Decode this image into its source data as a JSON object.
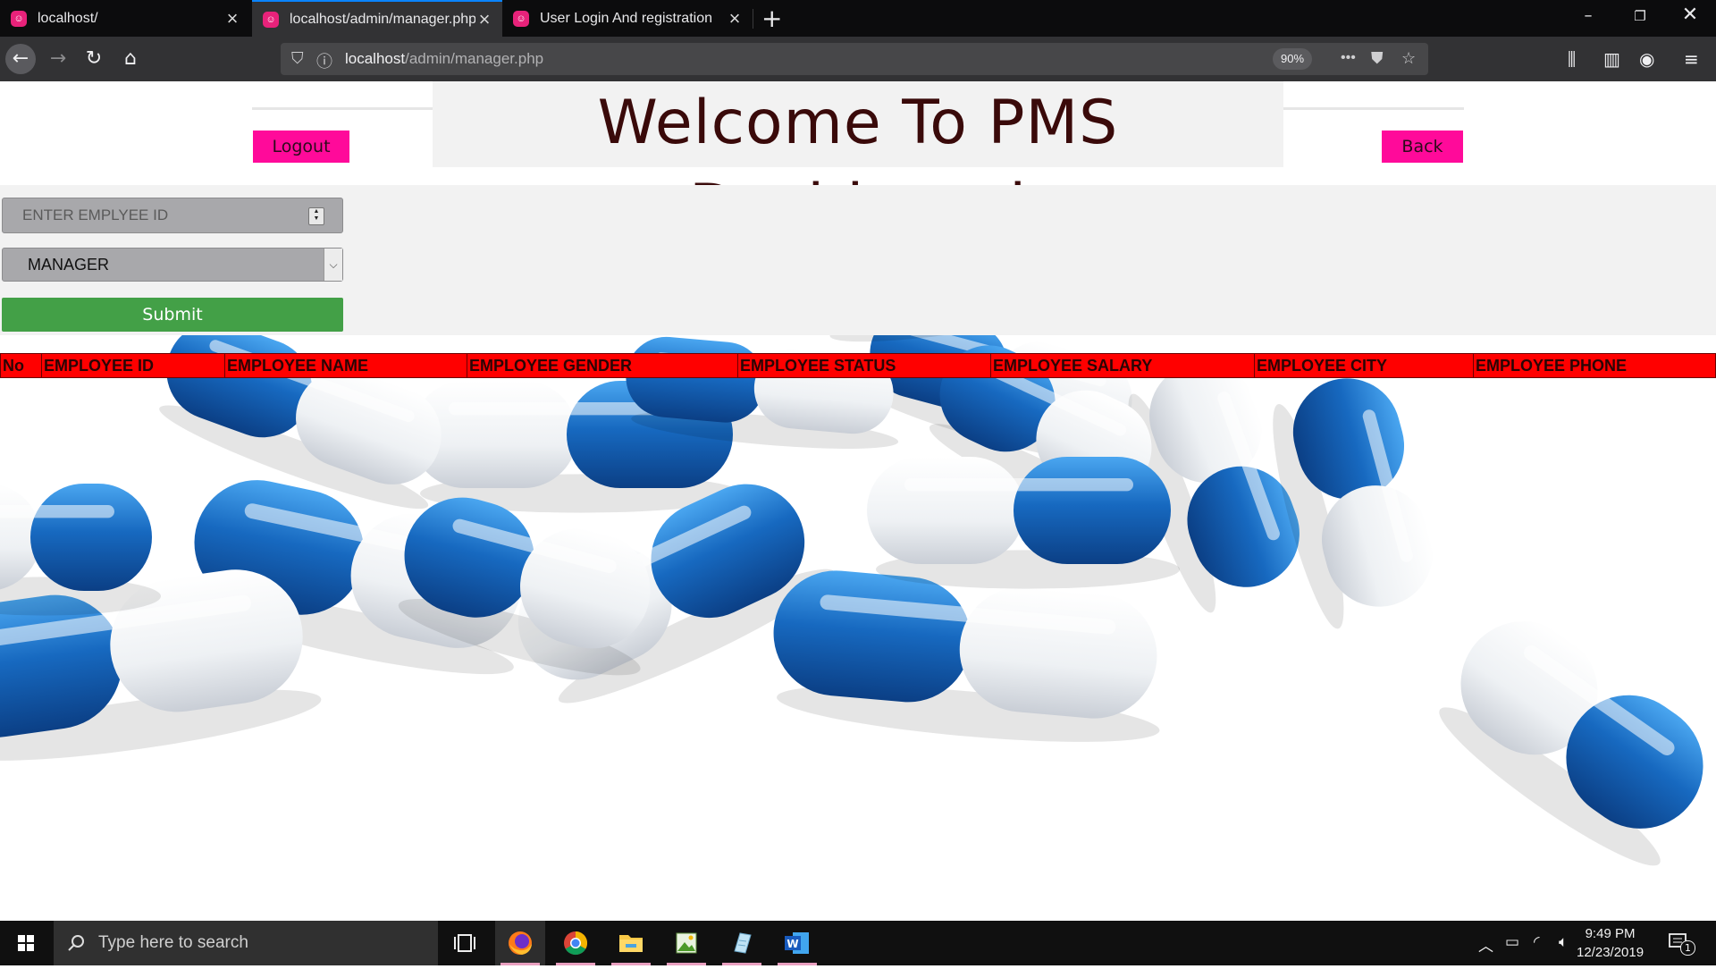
{
  "browser": {
    "tabs": [
      {
        "label": "localhost/",
        "active": false
      },
      {
        "label": "localhost/admin/manager.php",
        "active": true
      },
      {
        "label": "User Login And registration",
        "active": false
      }
    ],
    "url_host": "localhost",
    "url_path": "/admin/manager.php",
    "zoom": "90%",
    "accent_color": "#0a84ff"
  },
  "page": {
    "title": "Welcome To PMS Dashboard",
    "logout_label": "Logout",
    "back_label": "Back",
    "employee_id_placeholder": "ENTER EMPLYEE ID",
    "role_select_value": "MANAGER",
    "submit_label": "Submit",
    "table_headers": [
      "No",
      "EMPLOYEE ID",
      "EMPLOYEE NAME",
      "EMPLOYEE GENDER",
      "EMPLOYEE STATUS",
      "EMPLOYEE SALARY",
      "EMPLOYEE CITY",
      "EMPLOYEE PHONE"
    ],
    "colors": {
      "button_pink": "#ff0a9a",
      "submit_green": "#43a047",
      "table_header_red": "#ff0000"
    }
  },
  "taskbar": {
    "search_placeholder": "Type here to search",
    "apps": [
      "task-view-icon",
      "firefox-icon",
      "chrome-icon",
      "file-explorer-icon",
      "image-editor-icon",
      "notepad-icon",
      "word-icon"
    ],
    "time": "9:49 PM",
    "date": "12/23/2019",
    "notification_count": "1"
  }
}
